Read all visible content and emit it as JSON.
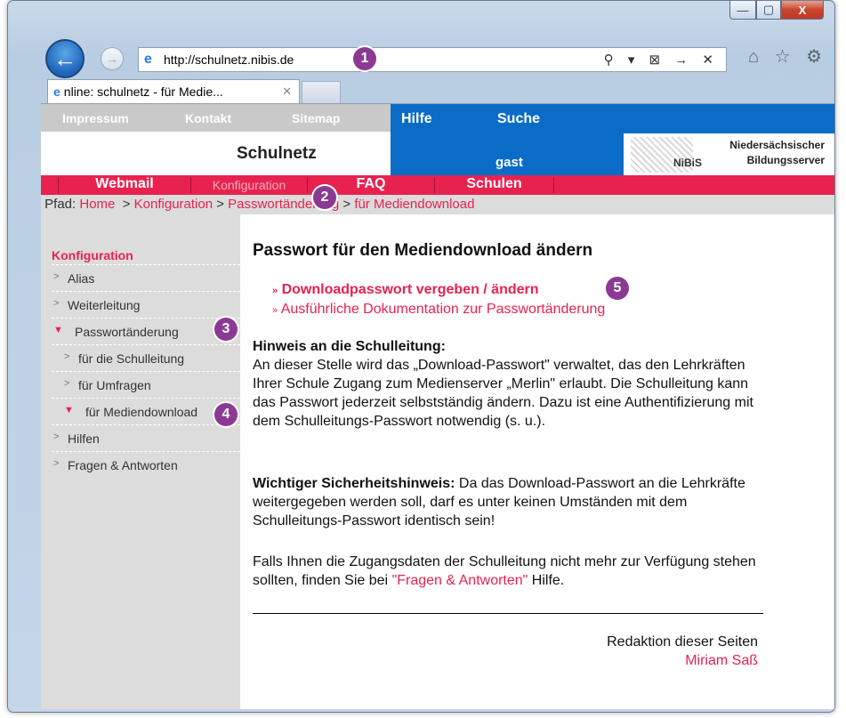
{
  "browser": {
    "url": "http://schulnetz.nibis.de",
    "tab_title": "nline: schulnetz - für Medie...",
    "tab_close": "✕",
    "address_tools": "⚲ ▾ ⊠ → ✕",
    "right_icons": "⌂ ☆ ⚙",
    "back_glyph": "←",
    "fwd_glyph": "→",
    "caption": {
      "min": "—",
      "max": "▢",
      "close": "X"
    }
  },
  "site": {
    "topnav": [
      "Impressum",
      "Kontakt",
      "Sitemap"
    ],
    "blue_links": [
      "Hilfe",
      "Suche"
    ],
    "user": "gast",
    "title": "Schulnetz",
    "logo_text": "NiBiS",
    "logo_line1": "Niedersächsischer",
    "logo_line2": "Bildungsserver",
    "rednav": [
      "Webmail",
      "Konfiguration",
      "FAQ",
      "Schulen"
    ]
  },
  "breadcrumb": {
    "label": "Pfad:",
    "home": "Home",
    "konfig": "Konfiguration",
    "pw": "Passwortänderung",
    "current": "für Mediendownload"
  },
  "sidebar": {
    "header": "Konfiguration",
    "items": [
      {
        "label": "Alias",
        "level": 1,
        "expanded": false
      },
      {
        "label": "Weiterleitung",
        "level": 1,
        "expanded": false
      },
      {
        "label": "Passwortänderung",
        "level": 1,
        "expanded": true
      },
      {
        "label": "für die Schulleitung",
        "level": 2,
        "expanded": false
      },
      {
        "label": "für Umfragen",
        "level": 2,
        "expanded": false
      },
      {
        "label": "für Mediendownload",
        "level": 2,
        "expanded": true
      },
      {
        "label": "Hilfen",
        "level": 1,
        "expanded": false
      },
      {
        "label": "Fragen & Antworten",
        "level": 1,
        "expanded": false
      }
    ]
  },
  "main": {
    "heading": "Passwort für den Mediendownload ändern",
    "link1": "Downloadpasswort vergeben / ändern",
    "link2": "Ausführliche Dokumentation zur Passwortänderung",
    "hint_title": "Hinweis an die Schulleitung:",
    "hint_body": "An dieser Stelle wird das „Download-Passwort\" verwaltet, das den Lehrkräften Ihrer Schule Zugang zum Medienserver „Merlin\" erlaubt. Die Schulleitung kann das Passwort jederzeit selbstständig ändern. Dazu ist eine Authentifizierung mit dem Schulleitungs-Passwort notwendig (s. u.).",
    "security_title": "Wichtiger Sicherheitshinweis:",
    "security_body": "Da das Download-Passwort an die Lehrkräfte weitergegeben werden soll, darf es unter keinen Umständen mit dem Schulleitungs-Passwort identisch sein!",
    "falls_text": "Falls Ihnen die Zugangsdaten der Schulleitung nicht mehr zur Verfügung stehen sollten, finden Sie bei",
    "falls_link": "\"Fragen & Antworten\"",
    "falls_end": "Hilfe.",
    "redaktion": "Redaktion dieser Seiten",
    "author": "Miriam Saß"
  },
  "badges": [
    "1",
    "2",
    "3",
    "4",
    "5"
  ],
  "colors": {
    "accent_red": "#e8224f",
    "blue": "#0b6cc8",
    "badge": "#8b3a93"
  }
}
